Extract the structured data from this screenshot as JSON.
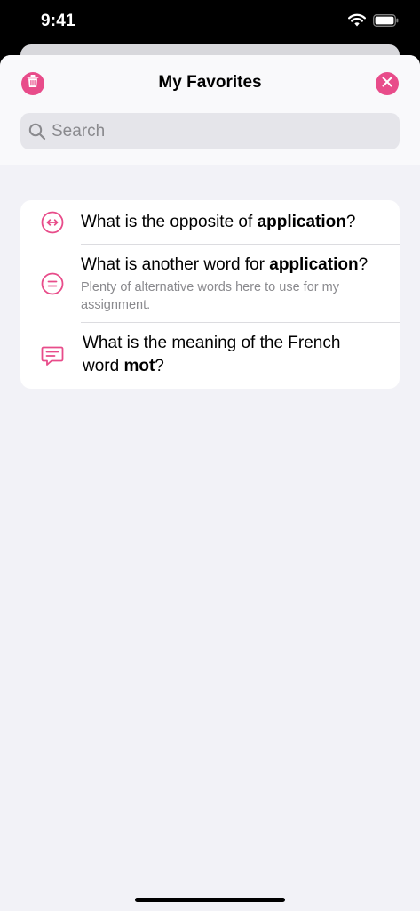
{
  "status_bar": {
    "time": "9:41"
  },
  "sheet": {
    "title": "My Favorites",
    "search_placeholder": "Search"
  },
  "items": [
    {
      "icon": "arrows-left-right-icon",
      "text_before": "What is the opposite of ",
      "keyword": "application",
      "text_after": "?",
      "subtitle": ""
    },
    {
      "icon": "equals-icon",
      "text_before": "What is another word for ",
      "keyword": "application",
      "text_after": "?",
      "subtitle": "Plenty of alternative words here to use for my assignment."
    },
    {
      "icon": "message-lines-icon",
      "text_before": "What is the meaning of the French word ",
      "keyword": "mot",
      "text_after": "?",
      "subtitle": ""
    }
  ],
  "colors": {
    "accent": "#e84c8a",
    "sheet_background": "#f2f2f7",
    "secondary_text": "#8a8a8e"
  }
}
